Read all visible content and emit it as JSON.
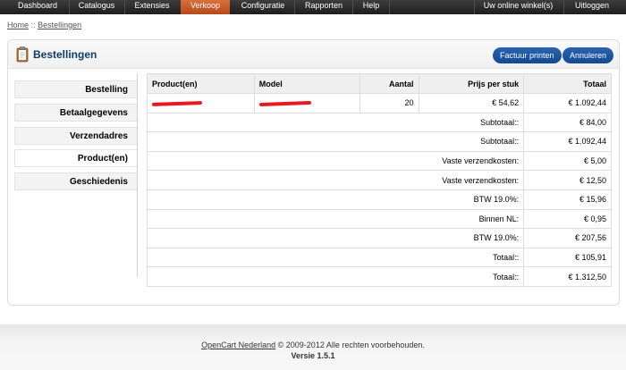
{
  "nav": {
    "items": [
      {
        "label": "Dashboard"
      },
      {
        "label": "Catalogus"
      },
      {
        "label": "Extensies"
      },
      {
        "label": "Verkoop",
        "active": true
      },
      {
        "label": "Configuratie"
      },
      {
        "label": "Rapporten"
      },
      {
        "label": "Help"
      }
    ],
    "store_link": "Uw online winkel(s)",
    "logout": "Uitloggen"
  },
  "breadcrumb": {
    "home": "Home",
    "separator": "::",
    "current": "Bestellingen"
  },
  "page": {
    "title": "Bestellingen",
    "icon": "clipboard-icon",
    "buttons": {
      "print_invoice": "Factuur printen",
      "cancel": "Annuleren"
    }
  },
  "tabs": [
    {
      "label": "Bestelling"
    },
    {
      "label": "Betaalgegevens"
    },
    {
      "label": "Verzendadres"
    },
    {
      "label": "Product(en)",
      "active": true
    },
    {
      "label": "Geschiedenis"
    }
  ],
  "table": {
    "headers": {
      "product": "Product(en)",
      "model": "Model",
      "quantity": "Aantal",
      "unit_price": "Prijs per stuk",
      "total": "Totaal"
    },
    "product_row": {
      "quantity": "20",
      "unit_price": "€ 54,62",
      "total": "€ 1.092,44"
    },
    "totals": [
      {
        "label": "Subtotaal::",
        "value": "€ 84,00"
      },
      {
        "label": "Subtotaal::",
        "value": "€ 1.092,44"
      },
      {
        "label": "Vaste verzendkosten:",
        "value": "€ 5,00"
      },
      {
        "label": "Vaste verzendkosten:",
        "value": "€ 12,50"
      },
      {
        "label": "BTW 19.0%:",
        "value": "€ 15,96"
      },
      {
        "label": "Binnen NL:",
        "value": "€ 0,95"
      },
      {
        "label": "BTW 19.0%:",
        "value": "€ 207,56"
      },
      {
        "label": "Totaal::",
        "value": "€ 105,91"
      },
      {
        "label": "Totaal::",
        "value": "€ 1.312,50"
      }
    ]
  },
  "footer": {
    "link": "OpenCart Nederland",
    "copyright": "© 2009-2012 Alle rechten voorbehouden.",
    "version": "Versie 1.5.1"
  },
  "colors": {
    "nav_bg": "#2a2a2a",
    "nav_active": "#c85a28",
    "title": "#0e3b6b",
    "button": "#1a55a3",
    "redaction": "#e8191f"
  }
}
